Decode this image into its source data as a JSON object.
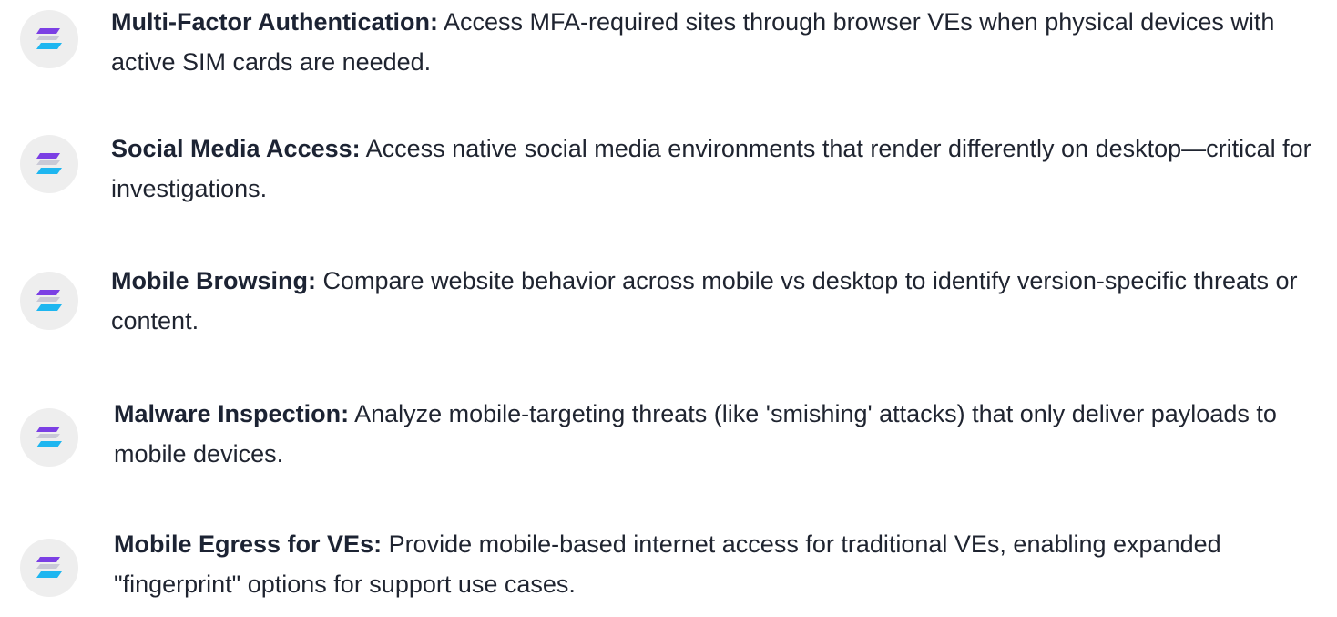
{
  "colors": {
    "text": "#1f2430",
    "badge_background": "#eeeeee",
    "icon_top": "#7b3fe4",
    "icon_middle": "#c9c9d6",
    "icon_bottom": "#1eb6f0"
  },
  "icon": "stacked-layers-icon",
  "features": [
    {
      "title": "Multi-Factor Authentication:",
      "description": "Access MFA-required sites through browser VEs when physical devices with active SIM cards are needed."
    },
    {
      "title": "Social Media Access:",
      "description": "Access native social media environments that render differently on desktop—critical for investigations."
    },
    {
      "title": "Mobile Browsing:",
      "description": "Compare website behavior across mobile vs desktop to identify version-specific threats or content."
    },
    {
      "title": "Malware Inspection:",
      "description": "Analyze mobile-targeting threats (like 'smishing' attacks) that only deliver payloads to mobile devices."
    },
    {
      "title": "Mobile Egress for VEs:",
      "description": "Provide mobile-based internet access for traditional VEs, enabling expanded \"fingerprint\" options for support use cases."
    }
  ]
}
